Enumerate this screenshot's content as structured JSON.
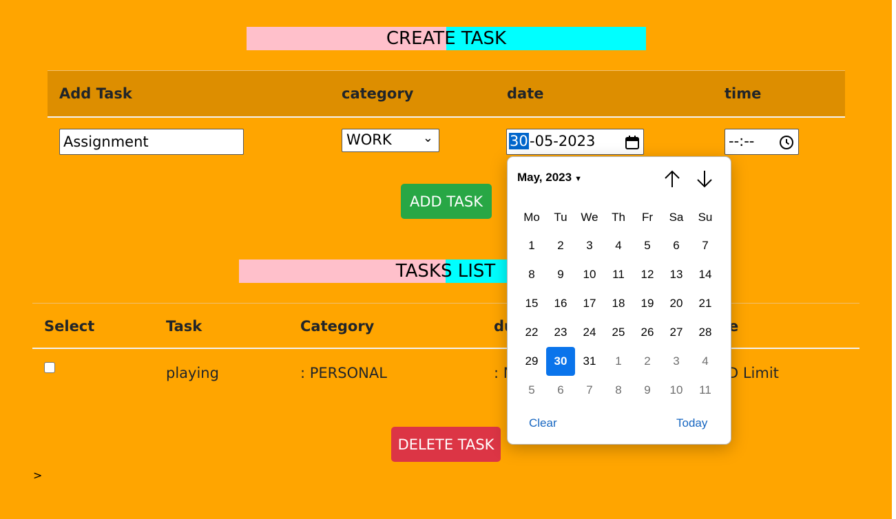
{
  "create_banner": "CREATE TASK",
  "form_headers": [
    "Add Task",
    "category",
    "date",
    "time"
  ],
  "task_input_value": "Assignment",
  "category_selected": "WORK",
  "date_value": {
    "day": "30",
    "rest": "-05-2023"
  },
  "time_value": "--:--",
  "add_button": "ADD TASK",
  "list_banner": "TASKS LIST",
  "list_headers": [
    "Select",
    "Task",
    "Category",
    "du",
    "e"
  ],
  "list_row": {
    "task": "playing",
    "category": ": PERSONAL",
    "due": ": N",
    "limit": "D Limit"
  },
  "delete_button": "DELETE TASK",
  "footer_text": ">",
  "picker": {
    "month_label": "May, 2023",
    "weekdays": [
      "Mo",
      "Tu",
      "We",
      "Th",
      "Fr",
      "Sa",
      "Su"
    ],
    "weeks": [
      [
        "1",
        "2",
        "3",
        "4",
        "5",
        "6",
        "7"
      ],
      [
        "8",
        "9",
        "10",
        "11",
        "12",
        "13",
        "14"
      ],
      [
        "15",
        "16",
        "17",
        "18",
        "19",
        "20",
        "21"
      ],
      [
        "22",
        "23",
        "24",
        "25",
        "26",
        "27",
        "28"
      ],
      [
        "29",
        "30",
        "31",
        "1",
        "2",
        "3",
        "4"
      ],
      [
        "5",
        "6",
        "7",
        "8",
        "9",
        "10",
        "11"
      ]
    ],
    "selected": "30",
    "clear_label": "Clear",
    "today_label": "Today"
  },
  "colors": {
    "background": "#ffa500",
    "header_band": "#dd8e00",
    "banner_pink": "#ffc0cb",
    "banner_cyan": "#00ffff",
    "add_button": "#28a745",
    "delete_button": "#dc3545",
    "picker_selected": "#0a74eb",
    "picker_link": "#1565c0"
  }
}
